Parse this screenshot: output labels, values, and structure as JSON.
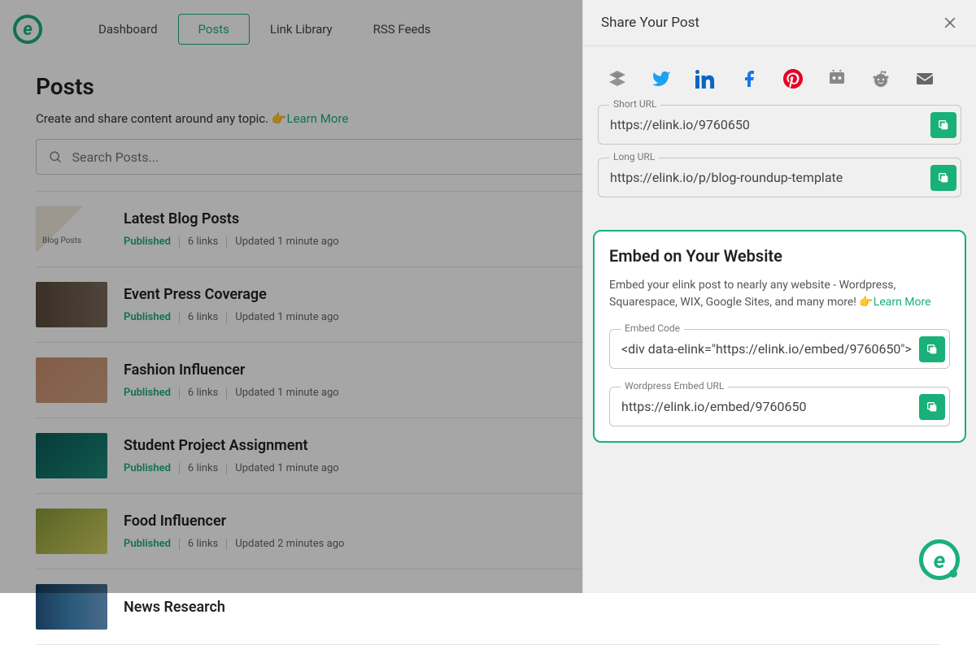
{
  "nav": {
    "dashboard": "Dashboard",
    "posts": "Posts",
    "link_library": "Link Library",
    "rss": "RSS Feeds"
  },
  "page": {
    "title": "Posts",
    "subtitle": "Create and share content around any topic. ",
    "learn_more": "Learn More"
  },
  "search": {
    "placeholder": "Search Posts..."
  },
  "posts": [
    {
      "title": "Latest Blog Posts",
      "status": "Published",
      "links": "6 links",
      "updated": "Updated 1 minute ago",
      "thumb": "blog"
    },
    {
      "title": "Event Press Coverage",
      "status": "Published",
      "links": "6 links",
      "updated": "Updated 1 minute ago",
      "thumb": "event"
    },
    {
      "title": "Fashion Influencer",
      "status": "Published",
      "links": "6 links",
      "updated": "Updated 1 minute ago",
      "thumb": "fashion"
    },
    {
      "title": "Student Project Assignment",
      "status": "Published",
      "links": "6 links",
      "updated": "Updated 1 minute ago",
      "thumb": "student"
    },
    {
      "title": "Food Influencer",
      "status": "Published",
      "links": "6 links",
      "updated": "Updated 2 minutes ago",
      "thumb": "food"
    },
    {
      "title": "News Research",
      "status": "",
      "links": "",
      "updated": "",
      "thumb": "news"
    }
  ],
  "panel": {
    "title": "Share Your Post",
    "short_url_label": "Short URL",
    "short_url": "https://elink.io/9760650",
    "long_url_label": "Long URL",
    "long_url": "https://elink.io/p/blog-roundup-template",
    "embed_title": "Embed on Your Website",
    "embed_desc": "Embed your elink post to nearly any website - Wordpress, Squarespace, WIX, Google Sites, and many more! ",
    "embed_learn_more": "Learn More",
    "embed_code_label": "Embed Code",
    "embed_code": "<div data-elink=\"https://elink.io/embed/9760650\">",
    "wp_label": "Wordpress Embed URL",
    "wp_url": "https://elink.io/embed/9760650"
  }
}
